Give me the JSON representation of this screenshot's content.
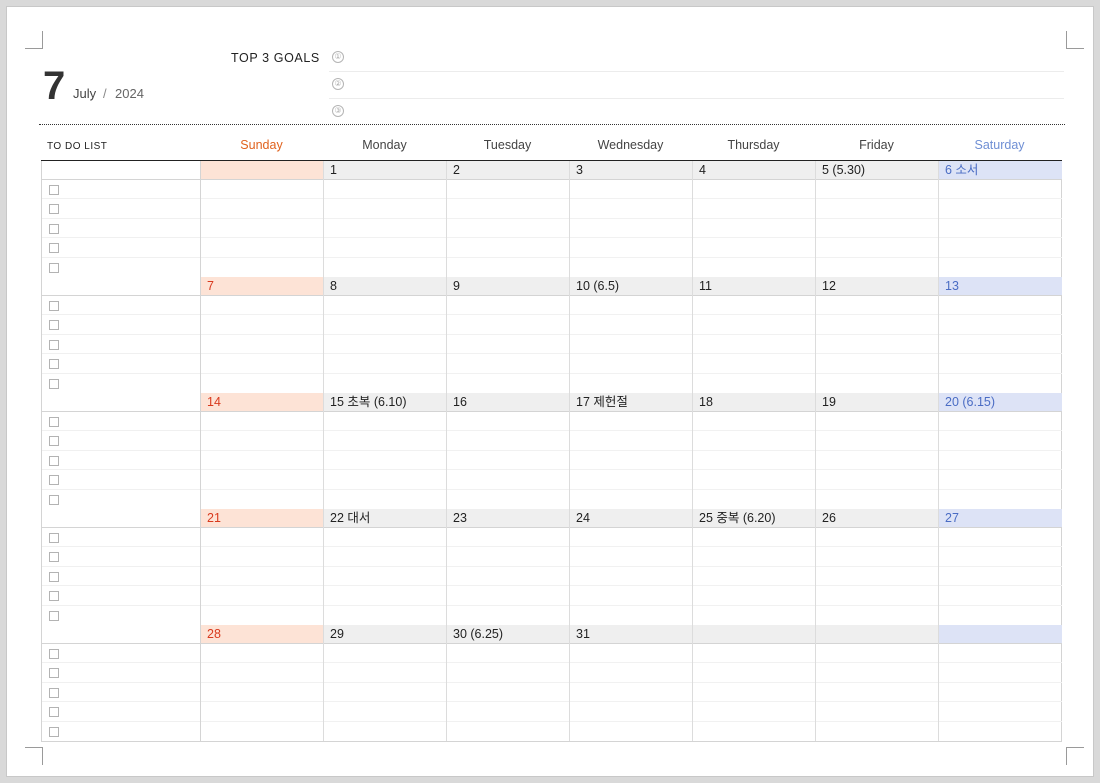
{
  "header": {
    "month_number": "7",
    "month_name": "July",
    "separator": "/",
    "year": "2024",
    "goals_title": "TOP 3 GOALS",
    "goal_marks": [
      "①",
      "②",
      "③"
    ],
    "todo_title": "TO DO LIST"
  },
  "days_of_week": [
    "Sunday",
    "Monday",
    "Tuesday",
    "Wednesday",
    "Thursday",
    "Friday",
    "Saturday"
  ],
  "weeks": [
    [
      "",
      "1",
      "2",
      "3",
      "4",
      "5  (5.30)",
      "6  소서"
    ],
    [
      "7",
      "8",
      "9",
      "10  (6.5)",
      "11",
      "12",
      "13"
    ],
    [
      "14",
      "15  초복  (6.10)",
      "16",
      "17  제헌절",
      "18",
      "19",
      "20  (6.15)"
    ],
    [
      "21",
      "22  대서",
      "23",
      "24",
      "25  중복  (6.20)",
      "26",
      "27"
    ],
    [
      "28",
      "29",
      "30  (6.25)",
      "31",
      "",
      "",
      ""
    ]
  ],
  "colors": {
    "sunday_text": "#e0621e",
    "sunday_fill": "#fde3d6",
    "saturday_text": "#6f8fd4",
    "saturday_fill": "#dde3f6",
    "weekday_fill": "#efefef"
  }
}
